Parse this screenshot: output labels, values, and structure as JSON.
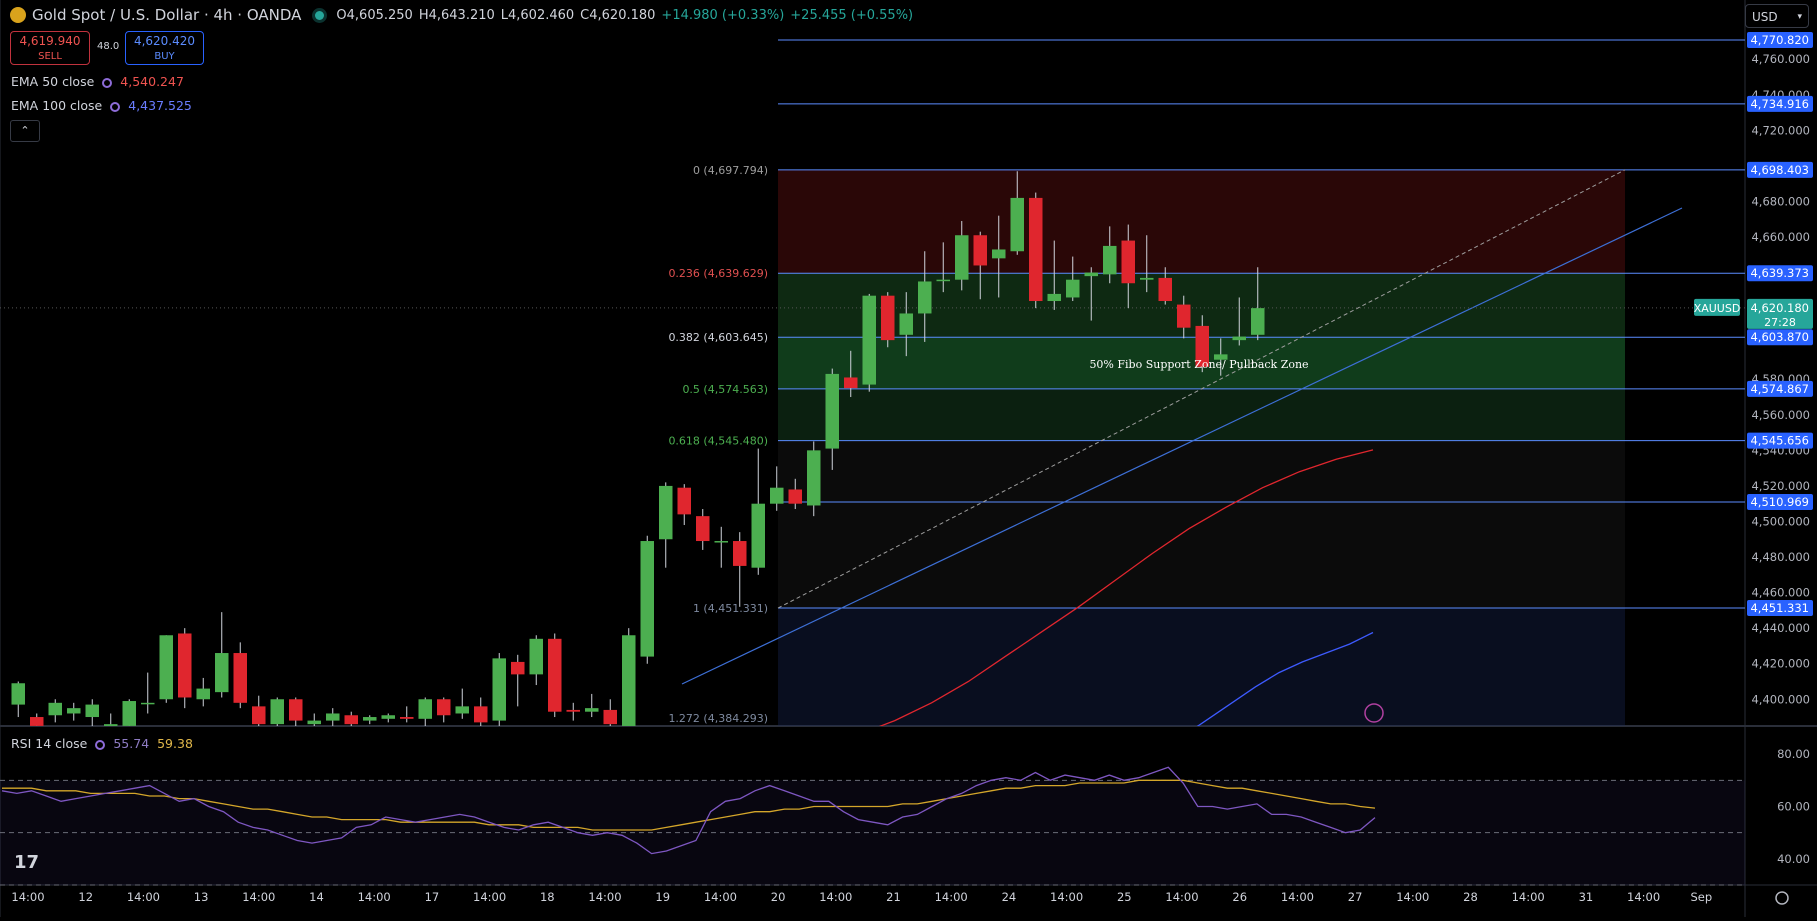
{
  "header": {
    "title": "Gold Spot / U.S. Dollar · 4h · OANDA",
    "open": "O4,605.250",
    "high": "H4,643.210",
    "low": "L4,602.460",
    "close": "C4,620.180",
    "change": "+14.980 (+0.33%)",
    "change2": "+25.455 (+0.55%)"
  },
  "trade": {
    "sell_price": "4,619.940",
    "sell_label": "SELL",
    "spread": "48.0",
    "buy_price": "4,620.420",
    "buy_label": "BUY"
  },
  "indicators": {
    "ema50_label": "EMA 50 close",
    "ema50_value": "4,540.247",
    "ema100_label": "EMA 100 close",
    "ema100_value": "4,437.525",
    "rsi_label": "RSI 14 close",
    "rsi_value": "55.74",
    "rsi_ma_value": "59.38"
  },
  "currency_selector": "USD",
  "colors": {
    "bull": "#4caf50",
    "bear": "#e0262e",
    "fib_line": "#5b8cff",
    "ema50": "#e0262e",
    "ema100": "#3d5afe",
    "rsi": "#7e57c2",
    "rsi_ma": "#d4a62a",
    "label_blue": "#2962ff",
    "price_green": "#26a69a"
  },
  "chart_data": {
    "type": "candlestick",
    "symbol": "XAUUSD",
    "timeframe": "4h",
    "ylim": [
      4385,
      4785
    ],
    "y_ticks": [
      4400,
      4420,
      4440,
      4460,
      4480,
      4500,
      4520,
      4540,
      4560,
      4580,
      4660,
      4680,
      4720,
      4740,
      4760
    ],
    "x_ticks": [
      "14:00",
      "12",
      "14:00",
      "13",
      "14:00",
      "14",
      "14:00",
      "17",
      "14:00",
      "18",
      "14:00",
      "19",
      "14:00",
      "20",
      "14:00",
      "21",
      "14:00",
      "24",
      "14:00",
      "25",
      "14:00",
      "26",
      "14:00",
      "27",
      "14:00",
      "28",
      "14:00",
      "31",
      "14:00",
      "Sep"
    ],
    "candles": [
      {
        "o": 4397,
        "c": 4409,
        "h": 4410,
        "l": 4390
      },
      {
        "o": 4390,
        "c": 4385,
        "h": 4392,
        "l": 4384
      },
      {
        "o": 4391,
        "c": 4398,
        "h": 4400,
        "l": 4387
      },
      {
        "o": 4392,
        "c": 4395,
        "h": 4398,
        "l": 4388
      },
      {
        "o": 4390,
        "c": 4397,
        "h": 4400,
        "l": 4384
      },
      {
        "o": 4384,
        "c": 4386,
        "h": 4392,
        "l": 4380
      },
      {
        "o": 4385,
        "c": 4399,
        "h": 4400,
        "l": 4381
      },
      {
        "o": 4398,
        "c": 4398,
        "h": 4415,
        "l": 4392
      },
      {
        "o": 4400,
        "c": 4436,
        "h": 4436,
        "l": 4398
      },
      {
        "o": 4437,
        "c": 4401,
        "h": 4440,
        "l": 4395
      },
      {
        "o": 4400,
        "c": 4406,
        "h": 4412,
        "l": 4396
      },
      {
        "o": 4404,
        "c": 4426,
        "h": 4449,
        "l": 4401
      },
      {
        "o": 4426,
        "c": 4398,
        "h": 4432,
        "l": 4395
      },
      {
        "o": 4396,
        "c": 4386,
        "h": 4402,
        "l": 4380
      },
      {
        "o": 4386,
        "c": 4400,
        "h": 4401,
        "l": 4384
      },
      {
        "o": 4400,
        "c": 4388,
        "h": 4401,
        "l": 4382
      },
      {
        "o": 4386,
        "c": 4388,
        "h": 4392,
        "l": 4384
      },
      {
        "o": 4388,
        "c": 4392,
        "h": 4395,
        "l": 4385
      },
      {
        "o": 4391,
        "c": 4386,
        "h": 4393,
        "l": 4380
      },
      {
        "o": 4388,
        "c": 4390,
        "h": 4391,
        "l": 4386
      },
      {
        "o": 4389,
        "c": 4391,
        "h": 4392,
        "l": 4387
      },
      {
        "o": 4390,
        "c": 4389,
        "h": 4396,
        "l": 4387
      },
      {
        "o": 4389,
        "c": 4400,
        "h": 4401,
        "l": 4383
      },
      {
        "o": 4400,
        "c": 4391,
        "h": 4401,
        "l": 4387
      },
      {
        "o": 4392,
        "c": 4396,
        "h": 4406,
        "l": 4389
      },
      {
        "o": 4396,
        "c": 4387,
        "h": 4401,
        "l": 4384
      },
      {
        "o": 4388,
        "c": 4423,
        "h": 4426,
        "l": 4385
      },
      {
        "o": 4421,
        "c": 4414,
        "h": 4425,
        "l": 4396
      },
      {
        "o": 4414,
        "c": 4434,
        "h": 4436,
        "l": 4408
      },
      {
        "o": 4434,
        "c": 4393,
        "h": 4437,
        "l": 4390
      },
      {
        "o": 4394,
        "c": 4393,
        "h": 4398,
        "l": 4388
      },
      {
        "o": 4393,
        "c": 4395,
        "h": 4403,
        "l": 4390
      },
      {
        "o": 4394,
        "c": 4386,
        "h": 4400,
        "l": 4384
      },
      {
        "o": 4377,
        "c": 4436,
        "h": 4440,
        "l": 4372
      },
      {
        "o": 4424,
        "c": 4489,
        "h": 4492,
        "l": 4420
      },
      {
        "o": 4490,
        "c": 4520,
        "h": 4522,
        "l": 4474
      },
      {
        "o": 4519,
        "c": 4504,
        "h": 4521,
        "l": 4498
      },
      {
        "o": 4503,
        "c": 4489,
        "h": 4507,
        "l": 4484
      },
      {
        "o": 4489,
        "c": 4489,
        "h": 4497,
        "l": 4474
      },
      {
        "o": 4489,
        "c": 4475,
        "h": 4494,
        "l": 4452
      },
      {
        "o": 4474,
        "c": 4510,
        "h": 4541,
        "l": 4470
      },
      {
        "o": 4510,
        "c": 4519,
        "h": 4531,
        "l": 4506
      },
      {
        "o": 4518,
        "c": 4510,
        "h": 4524,
        "l": 4507
      },
      {
        "o": 4509,
        "c": 4540,
        "h": 4545,
        "l": 4503
      },
      {
        "o": 4541,
        "c": 4583,
        "h": 4586,
        "l": 4529
      },
      {
        "o": 4581,
        "c": 4575,
        "h": 4596,
        "l": 4570
      },
      {
        "o": 4577,
        "c": 4627,
        "h": 4628,
        "l": 4573
      },
      {
        "o": 4627,
        "c": 4602,
        "h": 4629,
        "l": 4598
      },
      {
        "o": 4605,
        "c": 4617,
        "h": 4629,
        "l": 4593
      },
      {
        "o": 4617,
        "c": 4635,
        "h": 4652,
        "l": 4601
      },
      {
        "o": 4636,
        "c": 4636,
        "h": 4657,
        "l": 4629
      },
      {
        "o": 4636,
        "c": 4661,
        "h": 4669,
        "l": 4630
      },
      {
        "o": 4661,
        "c": 4644,
        "h": 4663,
        "l": 4625
      },
      {
        "o": 4648,
        "c": 4653,
        "h": 4672,
        "l": 4626
      },
      {
        "o": 4652,
        "c": 4682,
        "h": 4697,
        "l": 4650
      },
      {
        "o": 4682,
        "c": 4624,
        "h": 4685,
        "l": 4620
      },
      {
        "o": 4624,
        "c": 4628,
        "h": 4658,
        "l": 4619
      },
      {
        "o": 4626,
        "c": 4636,
        "h": 4649,
        "l": 4624
      },
      {
        "o": 4638,
        "c": 4640,
        "h": 4643,
        "l": 4613
      },
      {
        "o": 4639,
        "c": 4655,
        "h": 4666,
        "l": 4634
      },
      {
        "o": 4658,
        "c": 4634,
        "h": 4667,
        "l": 4620
      },
      {
        "o": 4636,
        "c": 4637,
        "h": 4661,
        "l": 4629
      },
      {
        "o": 4637,
        "c": 4624,
        "h": 4643,
        "l": 4622
      },
      {
        "o": 4622,
        "c": 4609,
        "h": 4627,
        "l": 4603
      },
      {
        "o": 4610,
        "c": 4587,
        "h": 4616,
        "l": 4584
      },
      {
        "o": 4591,
        "c": 4594,
        "h": 4603,
        "l": 4582
      },
      {
        "o": 4602,
        "c": 4604,
        "h": 4626,
        "l": 4599
      },
      {
        "o": 4605,
        "c": 4620,
        "h": 4643,
        "l": 4602
      }
    ],
    "fib_levels": [
      {
        "label": "0 (4,697.794)",
        "value": 4697.794,
        "right_label": "4,698.403"
      },
      {
        "label": "0.236 (4,639.629)",
        "value": 4639.629,
        "right_label": "4,639.373"
      },
      {
        "label": "0.382 (4,603.645)",
        "value": 4603.645,
        "right_label": "4,603.870"
      },
      {
        "label": "0.5 (4,574.563)",
        "value": 4574.563,
        "right_label": "4,574.867"
      },
      {
        "label": "0.618 (4,545.480)",
        "value": 4545.48,
        "right_label": "4,545.656"
      },
      {
        "label": "1 (4,451.331)",
        "value": 4451.331,
        "right_label": "4,451.331"
      },
      {
        "label": "1.272 (4,384.293)",
        "value": 4384.293,
        "right_label": ""
      }
    ],
    "hlines": [
      {
        "value": 4770.82,
        "right_label": "4,770.820"
      },
      {
        "value": 4734.916,
        "right_label": "4,734.916"
      },
      {
        "value": 4510.969,
        "right_label": "4,510.969"
      }
    ],
    "annotation": "50% Fibo Support Zone/ Pullback Zone",
    "current_price": {
      "label": "XAUUSD",
      "value": 4620.18,
      "value_text": "4,620.180",
      "countdown": "27:28"
    },
    "ema50": [
      4380,
      4388,
      4398,
      4410,
      4424,
      4438,
      4452,
      4467,
      4482,
      4496,
      4508,
      4519,
      4528,
      4535,
      4540.247
    ],
    "ema100": [
      4363,
      4371,
      4380,
      4389,
      4398,
      4407,
      4415,
      4421,
      4426,
      4431,
      4437.525
    ],
    "rsi": {
      "ylim": [
        30,
        90
      ],
      "levels": [
        70,
        50,
        30
      ],
      "ticks": [
        80,
        60,
        40
      ],
      "rsi_values": [
        66,
        65,
        66,
        64,
        62,
        63,
        64,
        65,
        66,
        67,
        68,
        65,
        62,
        63,
        60,
        58,
        54,
        52,
        51,
        49,
        47,
        46,
        47,
        48,
        52,
        53,
        56,
        55,
        54,
        55,
        56,
        57,
        56,
        54,
        52,
        51,
        53,
        54,
        52,
        50,
        49,
        50,
        49,
        46,
        42,
        43,
        45,
        47,
        58,
        62,
        63,
        66,
        68,
        66,
        64,
        62,
        62,
        58,
        55,
        54,
        53,
        56,
        57,
        60,
        63,
        65,
        68,
        70,
        71,
        70,
        73,
        70,
        72,
        71,
        70,
        72,
        70,
        71,
        73,
        75,
        69,
        60,
        60,
        59,
        60,
        61,
        57,
        57,
        56,
        54,
        52,
        50,
        51,
        55.74
      ],
      "ma_values": [
        67,
        67,
        67,
        66,
        66,
        66,
        65,
        65,
        65,
        65,
        64,
        64,
        63,
        63,
        62,
        61,
        60,
        59,
        59,
        58,
        57,
        56,
        56,
        55,
        55,
        55,
        55,
        54,
        54,
        54,
        54,
        54,
        54,
        53,
        53,
        53,
        52,
        52,
        52,
        52,
        51,
        51,
        51,
        51,
        51,
        52,
        53,
        54,
        55,
        56,
        57,
        58,
        58,
        59,
        59,
        60,
        60,
        60,
        60,
        60,
        60,
        61,
        61,
        62,
        63,
        64,
        65,
        66,
        67,
        67,
        68,
        68,
        68,
        69,
        69,
        69,
        69,
        70,
        70,
        70,
        70,
        69,
        68,
        67,
        67,
        66,
        65,
        64,
        63,
        62,
        61,
        61,
        60,
        59.38
      ]
    }
  }
}
